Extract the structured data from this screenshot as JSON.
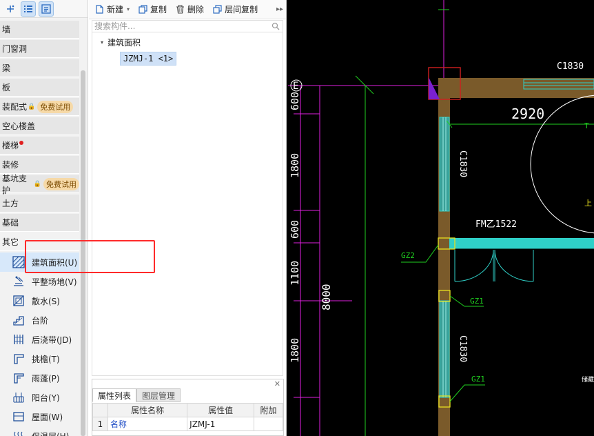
{
  "left_panel": {
    "categories": [
      {
        "label": "墙"
      },
      {
        "label": "门窗洞"
      },
      {
        "label": "梁"
      },
      {
        "label": "板"
      },
      {
        "label": "装配式",
        "badge": "免费试用"
      },
      {
        "label": "空心楼盖"
      },
      {
        "label": "楼梯"
      },
      {
        "label": "装修"
      },
      {
        "label": "基坑支护",
        "badge": "免费试用"
      },
      {
        "label": "土方"
      },
      {
        "label": "基础"
      },
      {
        "label": "其它"
      }
    ],
    "sub_items": [
      {
        "label": "建筑面积(U)",
        "icon": "building-area-icon"
      },
      {
        "label": "平整场地(V)",
        "icon": "site-leveling-icon"
      },
      {
        "label": "散水(S)",
        "icon": "apron-icon"
      },
      {
        "label": "台阶",
        "icon": "steps-icon"
      },
      {
        "label": "后浇带(JD)",
        "icon": "post-cast-strip-icon"
      },
      {
        "label": "挑檐(T)",
        "icon": "eave-icon"
      },
      {
        "label": "雨蓬(P)",
        "icon": "canopy-icon"
      },
      {
        "label": "阳台(Y)",
        "icon": "balcony-icon"
      },
      {
        "label": "屋面(W)",
        "icon": "roof-icon"
      },
      {
        "label": "保温层(H)",
        "icon": "insulation-icon"
      }
    ]
  },
  "mid_panel": {
    "toolbar": {
      "new_label": "新建",
      "copy_label": "复制",
      "delete_label": "删除",
      "floor_copy_label": "层间复制"
    },
    "search": {
      "placeholder": "搜索构件..."
    },
    "tree": {
      "root_label": "建筑面积",
      "leaf_label": "JZMJ-1 <1>"
    }
  },
  "properties": {
    "tabs": [
      "属性列表",
      "图层管理"
    ],
    "headers": {
      "name": "属性名称",
      "value": "属性值",
      "extra": "附加"
    },
    "rows": [
      {
        "num": "1",
        "name": "名称",
        "value": "JZMJ-1"
      }
    ]
  },
  "cad": {
    "labels": {
      "axis_e": "E",
      "window_top": "C1830",
      "span_width": "2920",
      "window_left_upper": "C1830",
      "door": "FM乙1522",
      "col_gz2": "GZ2",
      "col_gz1_a": "GZ1",
      "col_gz1_b": "GZ1",
      "window_left_lower": "C1830",
      "dim_total": "8000",
      "dim_600_a": "600",
      "dim_1800_a": "1800",
      "dim_600_b": "600",
      "dim_1100": "1100",
      "dim_1800_b": "1800",
      "room_text": "储藏"
    },
    "colors": {
      "wall": "#7a5a2a",
      "window": "#2fd0c8",
      "dim_line": "#e020e0",
      "green": "#20d020",
      "column": "#e8e020"
    }
  }
}
